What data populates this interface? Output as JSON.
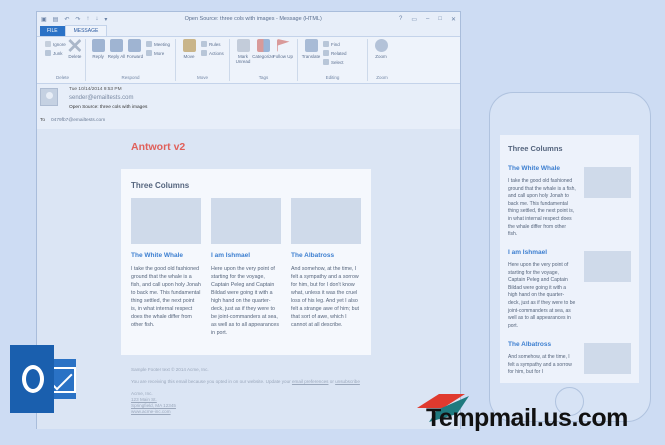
{
  "window": {
    "title": "Open Source: three cols with images - Message (HTML)",
    "controls": [
      "?",
      "▭",
      "–",
      "□",
      "✕"
    ]
  },
  "tabs": {
    "file": "FILE",
    "message": "MESSAGE"
  },
  "ribbon": {
    "delete_group": {
      "ignore": "Ignore",
      "junk": "Junk",
      "delete": "Delete",
      "name": "Delete"
    },
    "respond_group": {
      "reply": "Reply",
      "reply_all": "Reply All",
      "forward": "Forward",
      "meeting": "Meeting",
      "more": "More",
      "name": "Respond"
    },
    "move_group": {
      "move": "Move",
      "rules": "Rules",
      "actions": "Actions",
      "name": "Move"
    },
    "tags_group": {
      "mark_unread": "Mark Unread",
      "categorize": "Categorize",
      "follow_up": "Follow Up",
      "name": "Tags"
    },
    "editing_group": {
      "translate": "Translate",
      "find": "Find",
      "related": "Related",
      "select": "Select",
      "name": "Editing"
    },
    "zoom_group": {
      "zoom": "Zoom",
      "name": "Zoom"
    }
  },
  "header": {
    "date": "Tue 10/14/2014 9:53 PM",
    "from": "sender@emailtests.com",
    "subject": "Open Source: three cols with images",
    "to_label": "To",
    "to": "0479fb7@emailtests.com"
  },
  "email": {
    "heading": "Antwort v2",
    "section_title": "Three Columns",
    "columns": [
      {
        "title": "The White Whale",
        "text": "I take the good old fashioned ground that the whale is a fish, and call upon holy Jonah to back me. This fundamental thing settled, the next point is, in what internal respect does the whale differ from other fish."
      },
      {
        "title": "I am Ishmael",
        "text": "Here upon the very point of starting for the voyage, Captain Peleg and Captain Bildad were going it with a high hand on the quarter-deck, just as if they were to be joint-commanders at sea, as well as to all appearances in port."
      },
      {
        "title": "The Albatross",
        "text": "And somehow, at the time, I felt a sympathy and a sorrow for him, but for I don't know what, unless it was the cruel loss of his leg. And yet I also felt a strange awe of him; but that sort of awe, which I cannot at all describe."
      }
    ],
    "footer": {
      "line1": "Sample Footer text © 2014 Acme, Inc.",
      "line2a": "You are receiving this email because you opted in on our website. Update your ",
      "link_prefs": "email preferences",
      "line2b": " or ",
      "link_unsub": "unsubscribe",
      "address": [
        "Acme, Inc.",
        "123 Main St.",
        "Springfield, MA 12345",
        "www.acme-inc.com"
      ]
    }
  },
  "phone": {
    "section_title": "Three Columns",
    "items": [
      {
        "title": "The White Whale",
        "text": "I take the good old fashioned ground that the whale is a fish, and call upon holy Jonah to back me. This fundamental thing settled, the next point is, in what internal respect does the whale differ from other fish."
      },
      {
        "title": "I am Ishmael",
        "text": "Here upon the very point of starting for the voyage, Captain Peleg and Captain Bildad were going it with a high hand on the quarter-deck, just as if they were to be joint-commanders at sea, as well as to all appearances in port."
      },
      {
        "title": "The Albatross",
        "text": "And somehow, at the time, I felt a sympathy and a sorrow for him, but for I"
      }
    ]
  },
  "brand": {
    "text": "Tempmail.us.com"
  },
  "colors": {
    "accent": "#2b72c6",
    "heading_red": "#e0605a",
    "link_blue": "#3d7fd0"
  }
}
